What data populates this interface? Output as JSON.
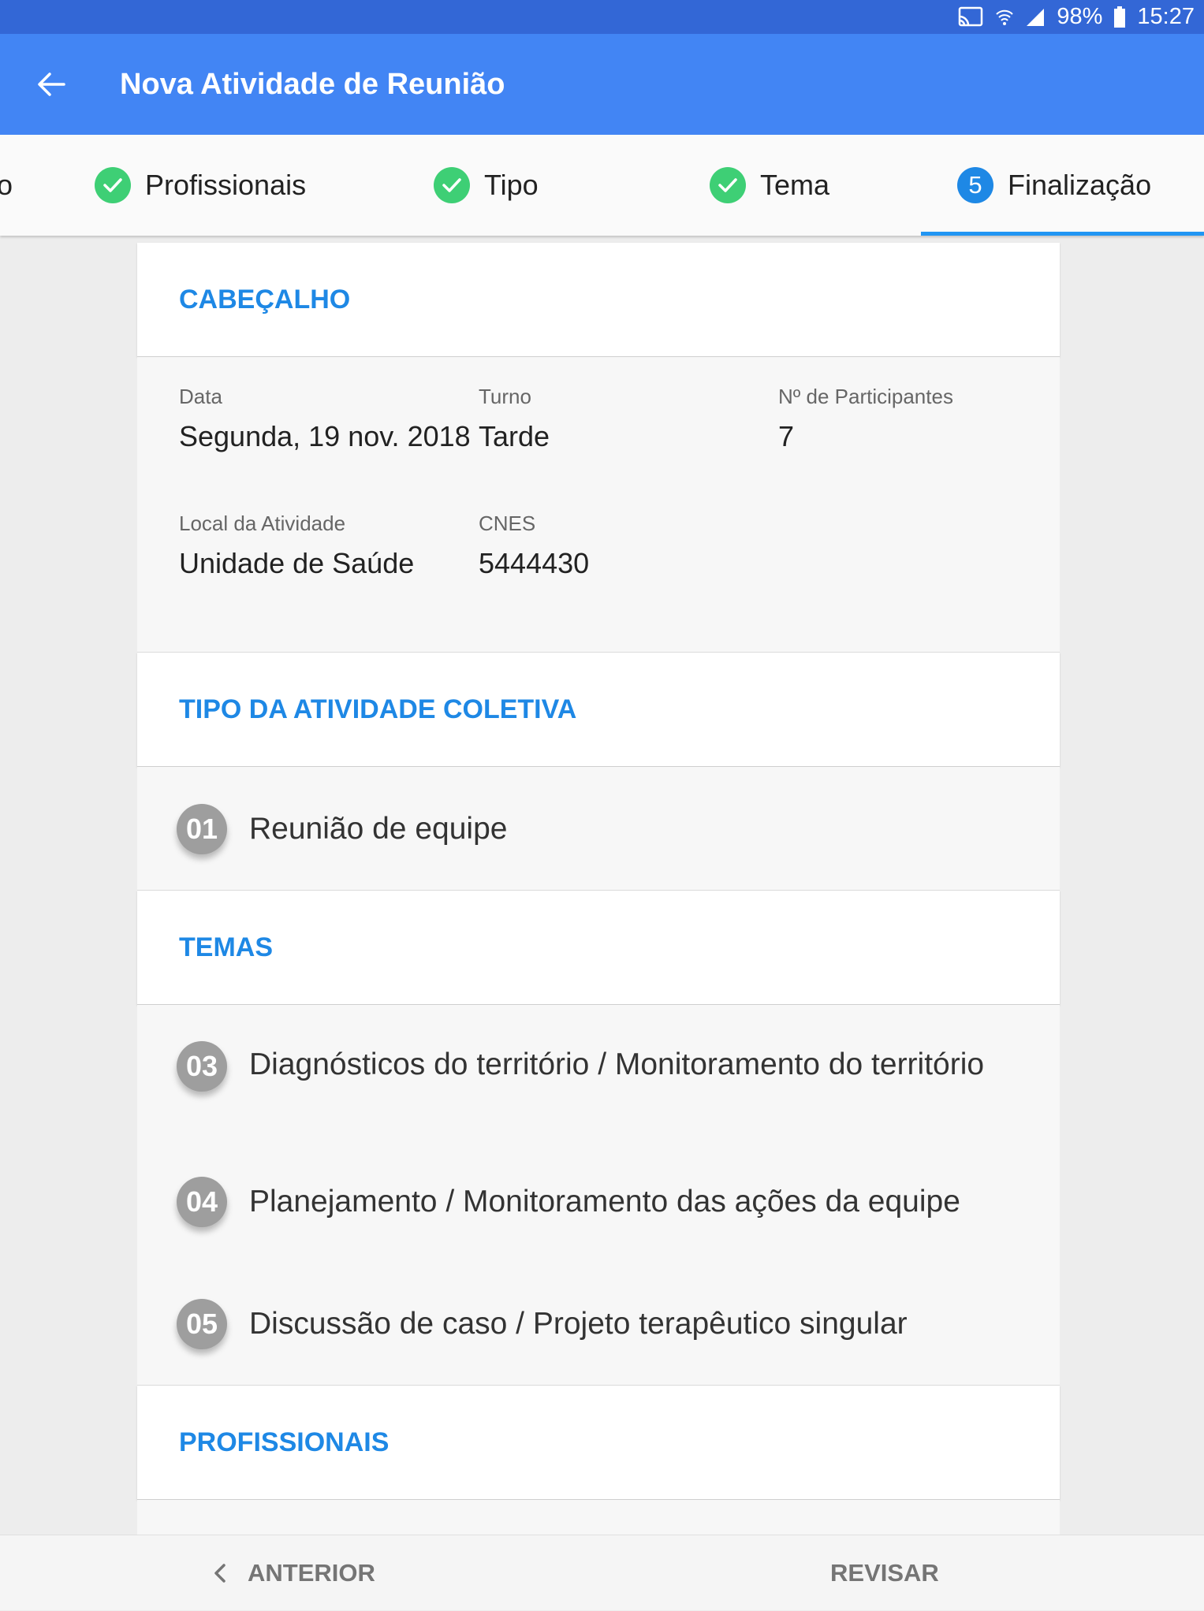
{
  "status_bar": {
    "battery": "98%",
    "time": "15:27"
  },
  "app_bar": {
    "title": "Nova Atividade de Reunião"
  },
  "stepper": {
    "partial_label": "o",
    "steps": [
      {
        "label": "Profissionais",
        "state": "done"
      },
      {
        "label": "Tipo",
        "state": "done"
      },
      {
        "label": "Tema",
        "state": "done"
      },
      {
        "label": "Finalização",
        "state": "active",
        "number": "5"
      }
    ]
  },
  "cabecalho": {
    "title": "CABEÇALHO",
    "data_label": "Data",
    "data_value": "Segunda, 19 nov. 2018",
    "turno_label": "Turno",
    "turno_value": "Tarde",
    "participantes_label": "Nº de Participantes",
    "participantes_value": "7",
    "local_label": "Local da Atividade",
    "local_value": "Unidade de Saúde",
    "cnes_label": "CNES",
    "cnes_value": "5444430"
  },
  "tipo": {
    "title": "TIPO DA ATIVIDADE COLETIVA",
    "items": [
      {
        "code": "01",
        "label": "Reunião de equipe"
      }
    ]
  },
  "temas": {
    "title": "TEMAS",
    "items": [
      {
        "code": "03",
        "label": "Diagnósticos do território / Monitoramento do território"
      },
      {
        "code": "04",
        "label": "Planejamento / Monitoramento das ações da equipe"
      },
      {
        "code": "05",
        "label": "Discussão de caso / Projeto terapêutico singular"
      }
    ]
  },
  "profissionais": {
    "title": "PROFISSIONAIS"
  },
  "bottom_nav": {
    "prev_label": "ANTERIOR",
    "next_label": "REVISAR"
  },
  "colors": {
    "primary": "#4285f4",
    "status_bar": "#3367d6",
    "accent": "#1e88e5",
    "done": "#3ecf75"
  }
}
